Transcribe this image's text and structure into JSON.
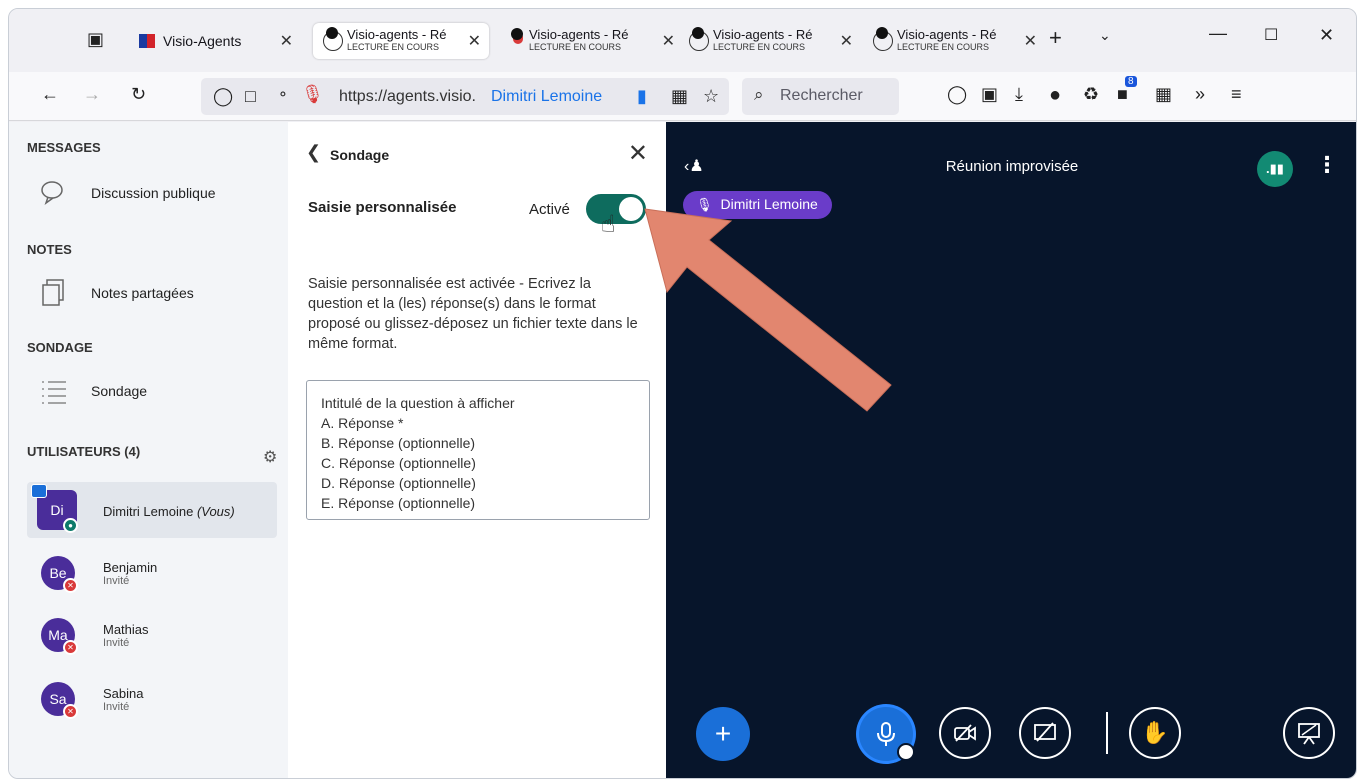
{
  "browser": {
    "tabs": [
      {
        "title": "Visio-Agents",
        "subtitle": ""
      },
      {
        "title": "Visio-agents - Ré",
        "subtitle": "LECTURE EN COURS"
      },
      {
        "title": "Visio-agents - Ré",
        "subtitle": "LECTURE EN COURS"
      },
      {
        "title": "Visio-agents - Ré",
        "subtitle": "LECTURE EN COURS"
      },
      {
        "title": "Visio-agents - Ré",
        "subtitle": "LECTURE EN COURS"
      }
    ],
    "url": "https://agents.visio.",
    "url_user": "Dimitri Lemoine",
    "search_placeholder": "Rechercher",
    "ext_badge": "8"
  },
  "sidebar": {
    "messages_title": "MESSAGES",
    "public_chat": "Discussion publique",
    "notes_title": "NOTES",
    "shared_notes": "Notes partagées",
    "poll_title": "SONDAGE",
    "poll_item": "Sondage",
    "users_title": "UTILISATEURS (4)",
    "users": [
      {
        "initials": "Di",
        "name": "Dimitri Lemoine",
        "suffix": "(Vous)",
        "role": ""
      },
      {
        "initials": "Be",
        "name": "Benjamin",
        "suffix": "",
        "role": "Invité"
      },
      {
        "initials": "Ma",
        "name": "Mathias",
        "suffix": "",
        "role": "Invité"
      },
      {
        "initials": "Sa",
        "name": "Sabina",
        "suffix": "",
        "role": "Invité"
      }
    ]
  },
  "poll": {
    "header": "Sondage",
    "custom_label": "Saisie personnalisée",
    "toggle_state": "Activé",
    "description": "Saisie personnalisée est activée - Ecrivez la question et la (les) réponse(s) dans le format proposé ou glissez-déposez un fichier texte dans le même format.",
    "textarea_lines": [
      "Intitulé de la question à afficher",
      "A. Réponse *",
      "B. Réponse (optionnelle)",
      "C. Réponse (optionnelle)",
      "D. Réponse (optionnelle)",
      "E. Réponse (optionnelle)"
    ]
  },
  "meeting": {
    "title": "Réunion improvisée",
    "speaker": "Dimitri Lemoine"
  },
  "colors": {
    "meeting_bg": "#07152b",
    "accent_blue": "#1a6fd8",
    "toggle_green": "#0e6c5e",
    "speaker_purple": "#6a3cc9",
    "arrow": "#e2866f"
  }
}
